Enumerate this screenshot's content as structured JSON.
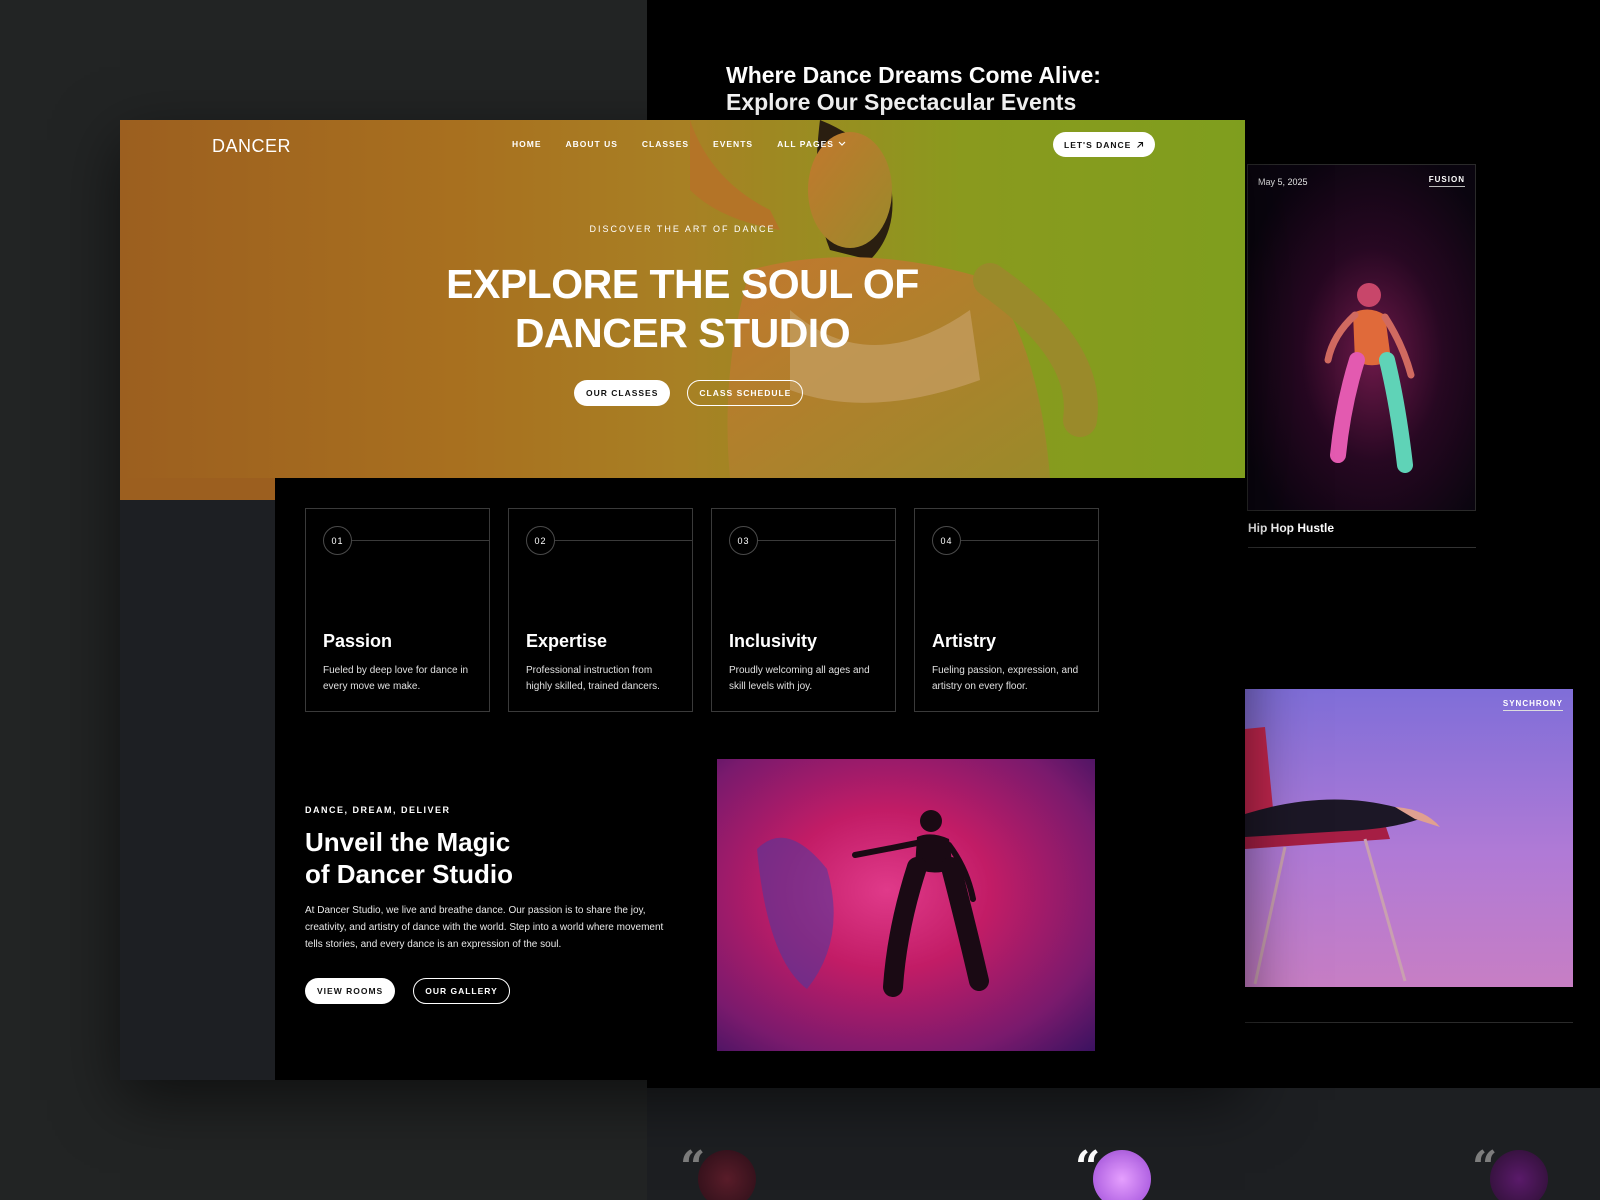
{
  "back": {
    "heading_line1": "Where Dance Dreams Come Alive:",
    "heading_line2": "Explore Our Spectacular Events",
    "event1": {
      "date": "May 5, 2025",
      "tag": "FUSION",
      "title": "Hip Hop Hustle"
    },
    "event2": {
      "tag": "SYNCHRONY"
    },
    "quote_glyph": "“"
  },
  "nav": {
    "logo": "DANCER",
    "items": [
      "HOME",
      "ABOUT US",
      "CLASSES",
      "EVENTS",
      "ALL PAGES"
    ],
    "cta": "LET'S DANCE"
  },
  "hero": {
    "eyebrow": "DISCOVER THE ART OF DANCE",
    "title_line1": "EXPLORE THE SOUL OF",
    "title_line2": "DANCER STUDIO",
    "btn_primary": "OUR CLASSES",
    "btn_secondary": "CLASS SCHEDULE"
  },
  "values": [
    {
      "num": "01",
      "title": "Passion",
      "desc": "Fueled by deep love for dance in every move we make."
    },
    {
      "num": "02",
      "title": "Expertise",
      "desc": "Professional instruction from highly skilled, trained dancers."
    },
    {
      "num": "03",
      "title": "Inclusivity",
      "desc": "Proudly welcoming all ages and skill levels with joy."
    },
    {
      "num": "04",
      "title": "Artistry",
      "desc": "Fueling passion, expression, and artistry on every floor."
    }
  ],
  "about": {
    "eyebrow": "DANCE, DREAM, DELIVER",
    "title_line1": "Unveil the Magic",
    "title_line2": "of Dancer Studio",
    "text": "At Dancer Studio, we live and breathe dance. Our passion is to share the joy, creativity, and artistry of dance with the world. Step into a world where movement tells stories, and every dance is an expression of the soul.",
    "btn_primary": "VIEW ROOMS",
    "btn_secondary": "OUR GALLERY"
  },
  "icons": {
    "nav_dropdown": "chevron-down-icon",
    "cta_arrow": "arrow-up-right-icon",
    "quote": "quote-icon"
  }
}
